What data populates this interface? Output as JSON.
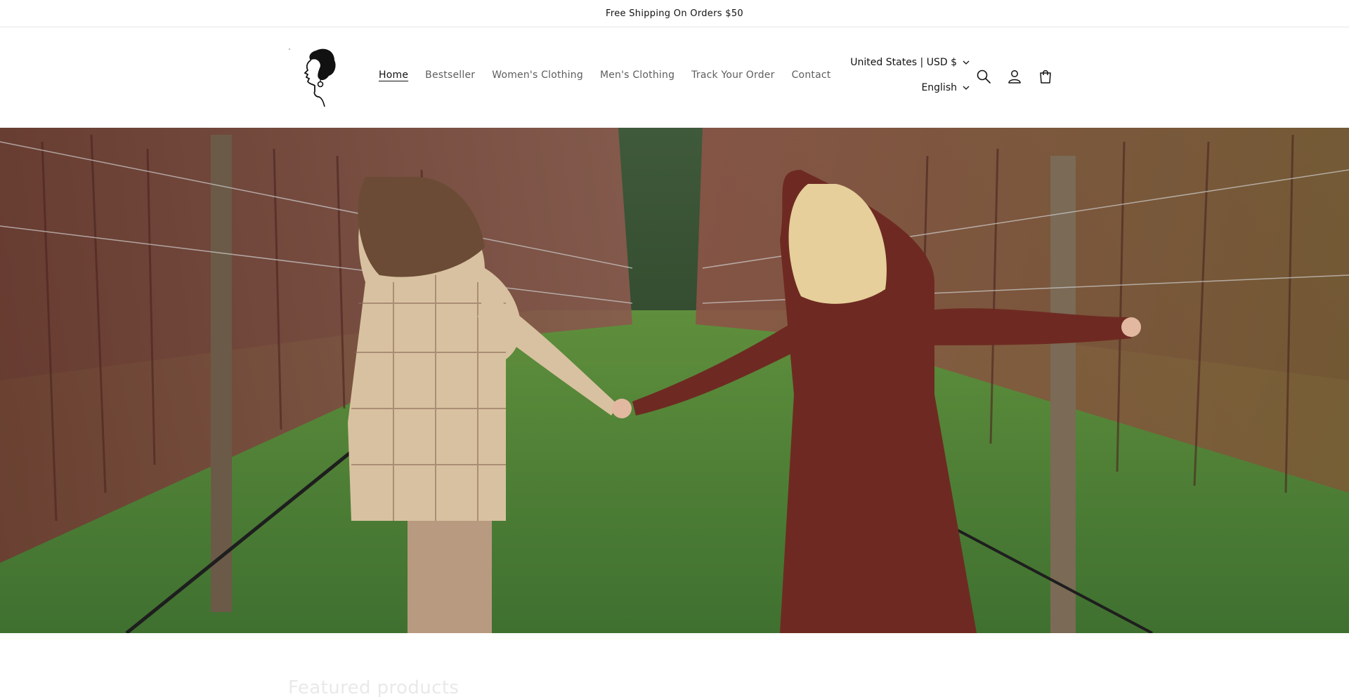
{
  "announcement": {
    "text": "Free Shipping On Orders $50"
  },
  "header": {
    "logo_name": "woman-silhouette-logo",
    "nav": [
      {
        "label": "Home",
        "active": true
      },
      {
        "label": "Bestseller",
        "active": false
      },
      {
        "label": "Women's Clothing",
        "active": false
      },
      {
        "label": "Men's Clothing",
        "active": false
      },
      {
        "label": "Track Your Order",
        "active": false
      },
      {
        "label": "Contact",
        "active": false
      }
    ],
    "country_selector": "United States | USD $",
    "language_selector": "English",
    "icons": [
      "search-icon",
      "account-icon",
      "cart-icon"
    ]
  },
  "hero": {
    "image_description_icon": "hero-image"
  },
  "main": {
    "section_heading": "Featured products"
  },
  "colors": {
    "text": "#121212",
    "nav_muted": "#5e5e5e",
    "border": "#e6e6e6"
  }
}
